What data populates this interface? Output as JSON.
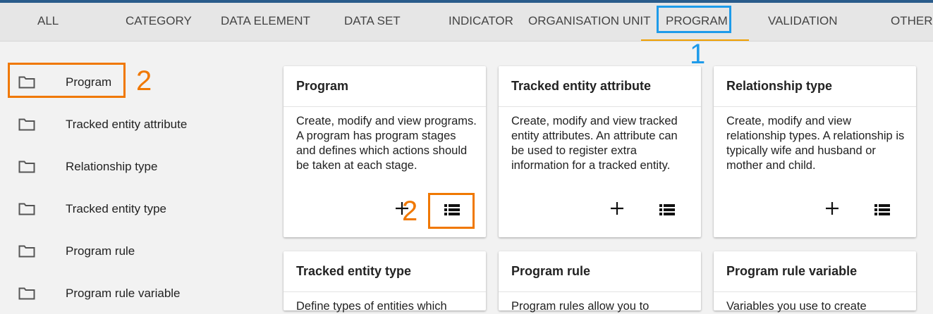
{
  "tabs": [
    "ALL",
    "CATEGORY",
    "DATA ELEMENT",
    "DATA SET",
    "INDICATOR",
    "ORGANISATION UNIT",
    "PROGRAM",
    "VALIDATION",
    "OTHER"
  ],
  "active_tab": "PROGRAM",
  "accent_colors": {
    "header_bar": "#2a5c8b",
    "tab_underline": "#f0a000",
    "annotation_blue": "#1e9bea",
    "annotation_orange": "#f07800"
  },
  "annotations": {
    "tab_marker": "1",
    "sidebar_marker": "2",
    "card_marker": "2"
  },
  "sidebar": {
    "items": [
      {
        "label": "Program",
        "icon": "folder-icon"
      },
      {
        "label": "Tracked entity attribute",
        "icon": "folder-icon"
      },
      {
        "label": "Relationship type",
        "icon": "folder-icon"
      },
      {
        "label": "Tracked entity type",
        "icon": "folder-icon"
      },
      {
        "label": "Program rule",
        "icon": "folder-icon"
      },
      {
        "label": "Program rule variable",
        "icon": "folder-icon"
      }
    ]
  },
  "cards": [
    {
      "title": "Program",
      "description": "Create, modify and view programs. A program has program stages and defines which actions should be taken at each stage."
    },
    {
      "title": "Tracked entity attribute",
      "description": "Create, modify and view tracked entity attributes. An attribute can be used to register extra information for a tracked entity."
    },
    {
      "title": "Relationship type",
      "description": "Create, modify and view relationship types. A relationship is typically wife and husband or mother and child."
    },
    {
      "title": "Tracked entity type",
      "description": "Define types of entities which"
    },
    {
      "title": "Program rule",
      "description": "Program rules allow you to"
    },
    {
      "title": "Program rule variable",
      "description": "Variables you use to create"
    }
  ]
}
